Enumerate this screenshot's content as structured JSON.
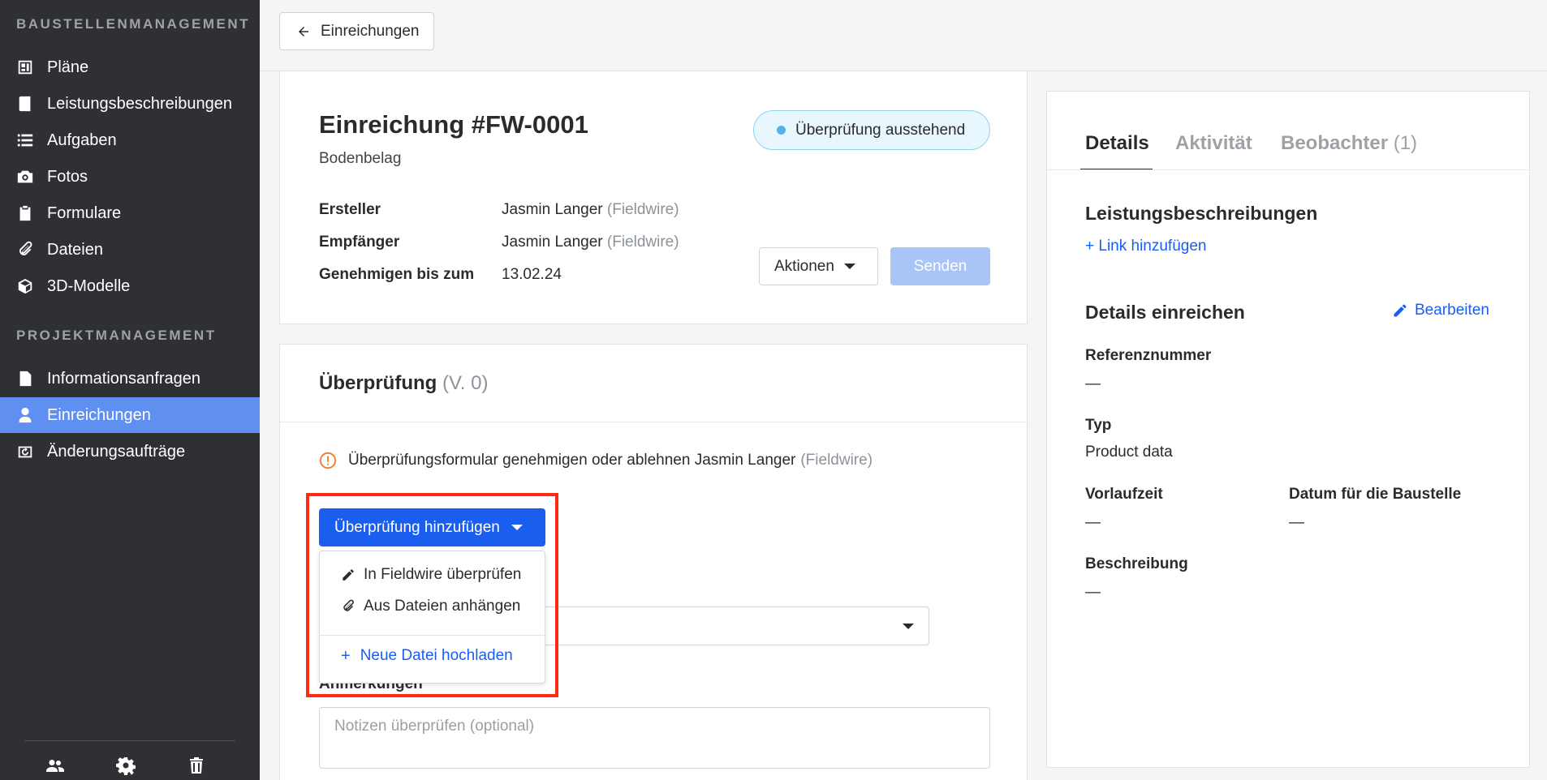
{
  "sidebar": {
    "section1": "BAUSTELLENMANAGEMENT",
    "section2": "PROJEKTMANAGEMENT",
    "items": [
      {
        "label": "Pläne",
        "icon": "plans-icon"
      },
      {
        "label": "Leistungsbeschreibungen",
        "icon": "notebook-icon"
      },
      {
        "label": "Aufgaben",
        "icon": "list-icon"
      },
      {
        "label": "Fotos",
        "icon": "camera-icon"
      },
      {
        "label": "Formulare",
        "icon": "clipboard-icon"
      },
      {
        "label": "Dateien",
        "icon": "paperclip-icon"
      },
      {
        "label": "3D-Modelle",
        "icon": "cube-icon"
      },
      {
        "label": "Informationsanfragen",
        "icon": "info-document-icon"
      },
      {
        "label": "Einreichungen",
        "icon": "submittal-icon",
        "active": true
      },
      {
        "label": "Änderungsaufträge",
        "icon": "change-order-icon"
      }
    ]
  },
  "topbar": {
    "back_label": "Einreichungen"
  },
  "submittal": {
    "title": "Einreichung #FW-0001",
    "subtitle": "Bodenbelag",
    "status": "Überprüfung ausstehend",
    "creator_label": "Ersteller",
    "creator_name": "Jasmin Langer",
    "creator_org": "(Fieldwire)",
    "recipient_label": "Empfänger",
    "recipient_name": "Jasmin Langer",
    "recipient_org": "(Fieldwire)",
    "due_label": "Genehmigen bis zum",
    "due_value": "13.02.24",
    "actions_label": "Aktionen",
    "send_label": "Senden"
  },
  "review": {
    "title": "Überprüfung",
    "version": "(V. 0)",
    "info_text": "Überprüfungsformular genehmigen oder ablehnen Jasmin Langer",
    "info_org": "(Fieldwire)",
    "add_button": "Überprüfung hinzufügen",
    "menu": {
      "item1": "In Fieldwire überprüfen",
      "item2": "Aus Dateien anhängen",
      "item3": "Neue Datei hochladen"
    },
    "notes_label": "Anmerkungen",
    "notes_placeholder": "Notizen überprüfen (optional)"
  },
  "details_panel": {
    "tabs": {
      "details": "Details",
      "activity": "Aktivität",
      "watchers": "Beobachter",
      "watchers_count": "(1)"
    },
    "specs_heading": "Leistungsbeschreibungen",
    "add_link": "+ Link hinzufügen",
    "submit_heading": "Details einreichen",
    "edit_label": "Bearbeiten",
    "ref_label": "Referenznummer",
    "ref_value": "—",
    "type_label": "Typ",
    "type_value": "Product data",
    "lead_label": "Vorlaufzeit",
    "lead_value": "—",
    "site_date_label": "Datum für die Baustelle",
    "site_date_value": "—",
    "desc_label": "Beschreibung",
    "desc_value": "—"
  },
  "colors": {
    "sidebar_bg": "#2f3033",
    "active_item": "#5f8ff0",
    "primary": "#1a5ef0",
    "highlight": "#ff2a12"
  }
}
